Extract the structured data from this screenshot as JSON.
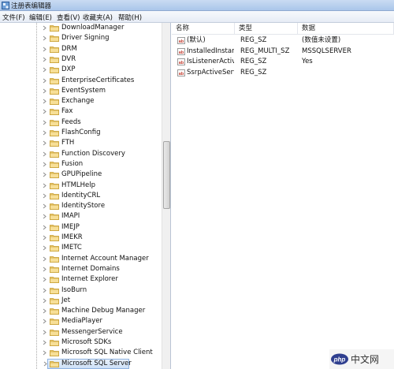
{
  "window": {
    "title": "注册表编辑器"
  },
  "menu": [
    "文件(F)",
    "编辑(E)",
    "查看(V)",
    "收藏夹(A)",
    "帮助(H)"
  ],
  "tree": {
    "items": [
      "DownloadManager",
      "Driver Signing",
      "DRM",
      "DVR",
      "DXP",
      "EnterpriseCertificates",
      "EventSystem",
      "Exchange",
      "Fax",
      "Feeds",
      "FlashConfig",
      "FTH",
      "Function Discovery",
      "Fusion",
      "GPUPipeline",
      "HTMLHelp",
      "IdentityCRL",
      "IdentityStore",
      "IMAPI",
      "IMEJP",
      "IMEKR",
      "IMETC",
      "Internet Account Manager",
      "Internet Domains",
      "Internet Explorer",
      "IsoBurn",
      "Jet",
      "Machine Debug Manager",
      "MediaPlayer",
      "MessengerService",
      "Microsoft SDKs",
      "Microsoft SQL Native Client",
      "Microsoft SQL Server"
    ],
    "selected": "Microsoft SQL Server"
  },
  "list": {
    "columns": [
      "名称",
      "类型",
      "数据"
    ],
    "rows": [
      {
        "name": "(默认)",
        "type": "REG_SZ",
        "data": "(数值未设置)"
      },
      {
        "name": "InstalledInstan...",
        "type": "REG_MULTI_SZ",
        "data": "MSSQLSERVER"
      },
      {
        "name": "IsListenerActive",
        "type": "REG_SZ",
        "data": "Yes"
      },
      {
        "name": "SsrpActiveServ...",
        "type": "REG_SZ",
        "data": ""
      }
    ]
  },
  "watermark": {
    "text": "php中文网"
  }
}
